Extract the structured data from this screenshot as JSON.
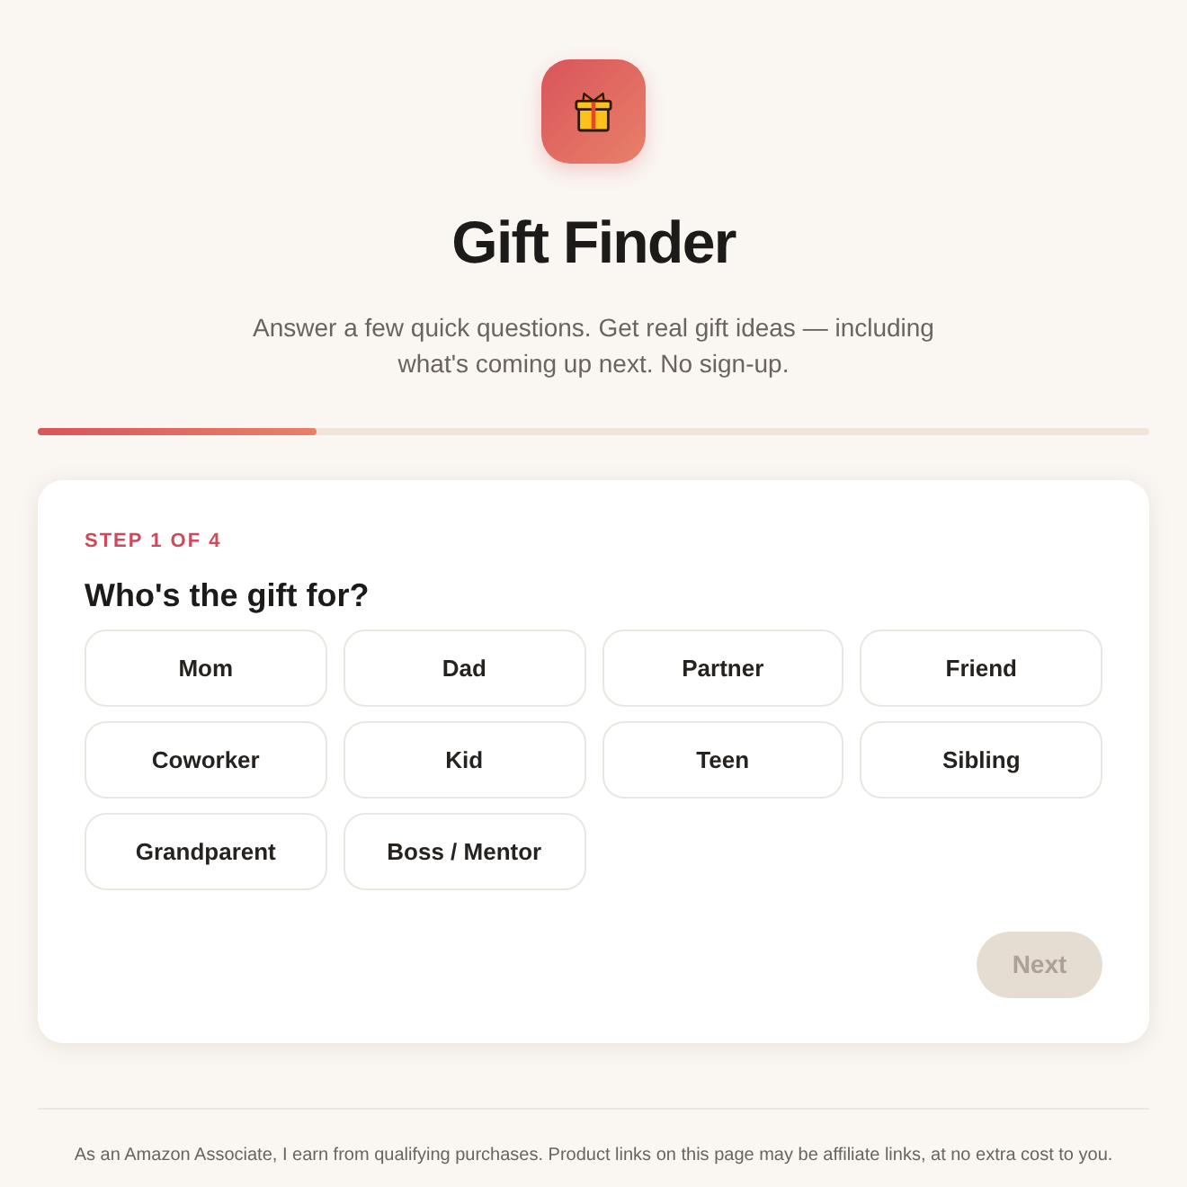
{
  "header": {
    "title": "Gift Finder",
    "subtitle": "Answer a few quick questions. Get real gift ideas — including what's coming up next. No sign-up."
  },
  "progress": {
    "level": 0.25
  },
  "step": {
    "label": "STEP 1 OF 4",
    "question": "Who's the gift for?",
    "options": [
      {
        "label": "Mom",
        "selected": false
      },
      {
        "label": "Dad",
        "selected": false
      },
      {
        "label": "Partner",
        "selected": false
      },
      {
        "label": "Friend",
        "selected": false
      },
      {
        "label": "Coworker",
        "selected": false
      },
      {
        "label": "Kid",
        "selected": false
      },
      {
        "label": "Teen",
        "selected": false
      },
      {
        "label": "Sibling",
        "selected": false
      },
      {
        "label": "Grandparent",
        "selected": false
      },
      {
        "label": "Boss / Mentor",
        "selected": false
      }
    ],
    "next_button": {
      "label": "Next",
      "disabled": true
    }
  },
  "footer": {
    "disclosure": "As an Amazon Associate, I earn from qualifying purchases. Product links on this page may be affiliate links, at no extra cost to you."
  }
}
